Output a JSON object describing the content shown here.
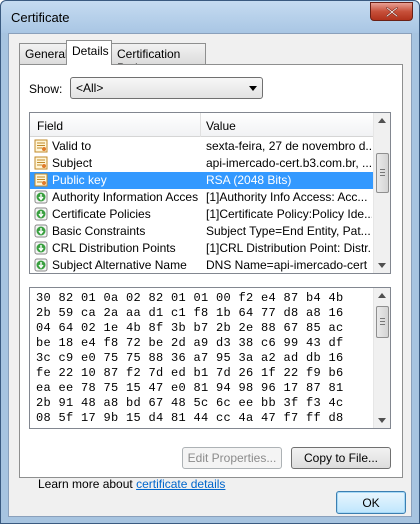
{
  "window": {
    "title": "Certificate"
  },
  "tabs": [
    {
      "label": "General",
      "active": false
    },
    {
      "label": "Details",
      "active": true
    },
    {
      "label": "Certification Path",
      "active": false
    }
  ],
  "show": {
    "label": "Show:",
    "selected": "<All>"
  },
  "fields_table": {
    "columns": [
      "Field",
      "Value"
    ],
    "rows": [
      {
        "icon": "certificate-doc-icon",
        "field": "Valid to",
        "value": "sexta-feira, 27 de novembro d...",
        "selected": false
      },
      {
        "icon": "certificate-doc-icon",
        "field": "Subject",
        "value": "api-imercado-cert.b3.com.br, ...",
        "selected": false
      },
      {
        "icon": "certificate-doc-icon",
        "field": "Public key",
        "value": "RSA (2048 Bits)",
        "selected": true
      },
      {
        "icon": "extension-arrow-icon",
        "field": "Authority Information Access",
        "value": "[1]Authority Info Access: Acc...",
        "selected": false
      },
      {
        "icon": "extension-arrow-icon",
        "field": "Certificate Policies",
        "value": "[1]Certificate Policy:Policy Ide...",
        "selected": false
      },
      {
        "icon": "extension-arrow-icon",
        "field": "Basic Constraints",
        "value": "Subject Type=End Entity, Pat...",
        "selected": false
      },
      {
        "icon": "extension-arrow-icon",
        "field": "CRL Distribution Points",
        "value": "[1]CRL Distribution Point: Distr...",
        "selected": false
      },
      {
        "icon": "extension-arrow-icon",
        "field": "Subject Alternative Name",
        "value": "DNS Name=api-imercado-cert",
        "selected": false
      }
    ]
  },
  "hex_value": [
    "30 82 01 0a 02 82 01 01 00 f2 e4 87 b4 4b",
    "2b 59 ca 2a aa d1 c1 f8 1b 64 77 d8 a8 16",
    "04 64 02 1e 4b 8f 3b b7 2b 2e 88 67 85 ac",
    "be 18 e4 f8 72 be 2d a9 d3 38 c6 99 43 df",
    "3c c9 e0 75 75 88 36 a7 95 3a a2 ad db 16",
    "fe 22 10 87 f2 7d ed b1 7d 26 1f 22 f9 b6",
    "ea ee 78 75 15 47 e0 81 94 98 96 17 87 81",
    "2b 91 48 a8 bd 67 48 5c 6c ee bb 3f f3 4c",
    "08 5f 17 9b 15 d4 81 44 cc 4a 47 f7 ff d8"
  ],
  "buttons": {
    "edit_properties": "Edit Properties...",
    "copy_to_file": "Copy to File...",
    "ok": "OK"
  },
  "learn_more": {
    "prefix": "Learn more about ",
    "link": "certificate details"
  },
  "colors": {
    "selection": "#3399ff",
    "link": "#0066cc",
    "frame": "#a7c4e0"
  }
}
